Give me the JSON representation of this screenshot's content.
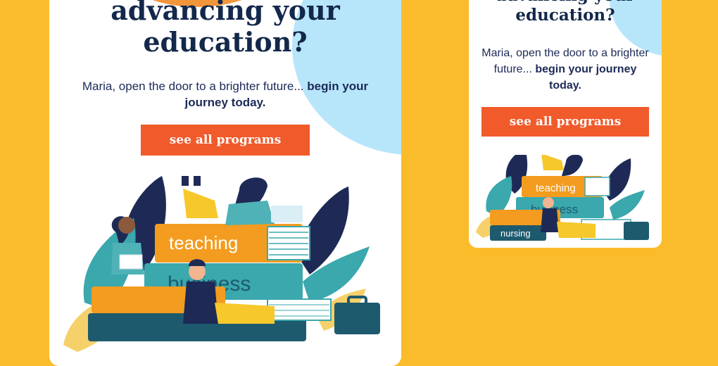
{
  "email": {
    "headline_line1": "advancing your",
    "headline_line2": "education?",
    "subtext_plain": "Maria, open the door to a brighter future...",
    "subtext_bold": "begin your journey today.",
    "cta_label": "see all programs"
  },
  "illustration": {
    "book_labels": [
      "teaching",
      "business",
      "nursing"
    ]
  },
  "colors": {
    "background": "#fbbc2c",
    "navy": "#13284b",
    "cta": "#f15a2b",
    "teal": "#3aa8ad",
    "book_orange": "#f39c1f",
    "light_blue": "#b7e6fb"
  }
}
